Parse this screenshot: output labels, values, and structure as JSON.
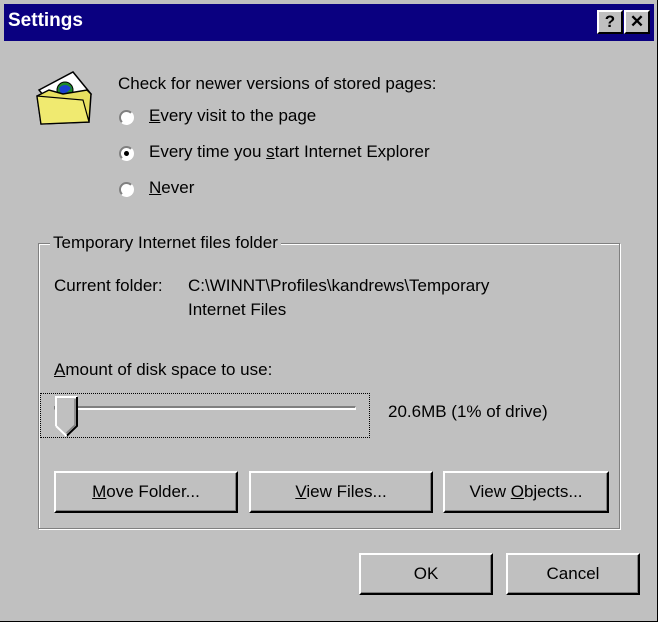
{
  "window": {
    "title": "Settings",
    "help_glyph": "?",
    "close_glyph": "✕"
  },
  "check": {
    "heading": "Check for newer versions of stored pages:",
    "options": [
      {
        "label_pre": "",
        "label_key": "E",
        "label_post": "very visit to the page",
        "selected": false
      },
      {
        "label_pre": "Every time you ",
        "label_key": "s",
        "label_post": "tart Internet Explorer",
        "selected": true
      },
      {
        "label_pre": "",
        "label_key": "N",
        "label_post": "ever",
        "selected": false
      }
    ]
  },
  "temp_folder": {
    "group_title": "Temporary Internet files folder",
    "current_label": "Current folder:",
    "current_path_line1": "C:\\WINNT\\Profiles\\kandrews\\Temporary",
    "current_path_line2": "Internet Files",
    "disk_label_key": "A",
    "disk_label_post": "mount of disk space to use:",
    "disk_value": "20.6MB (1% of drive)",
    "slider_fraction": 0.01
  },
  "buttons": {
    "move_key": "M",
    "move_post": "ove Folder...",
    "view_files_key": "V",
    "view_files_post": "iew Files...",
    "view_objects_pre": "View ",
    "view_objects_key": "O",
    "view_objects_post": "bjects...",
    "ok": "OK",
    "cancel": "Cancel"
  },
  "icons": {
    "folder": "folder-with-globe-icon",
    "help": "help-icon",
    "close": "close-icon"
  }
}
